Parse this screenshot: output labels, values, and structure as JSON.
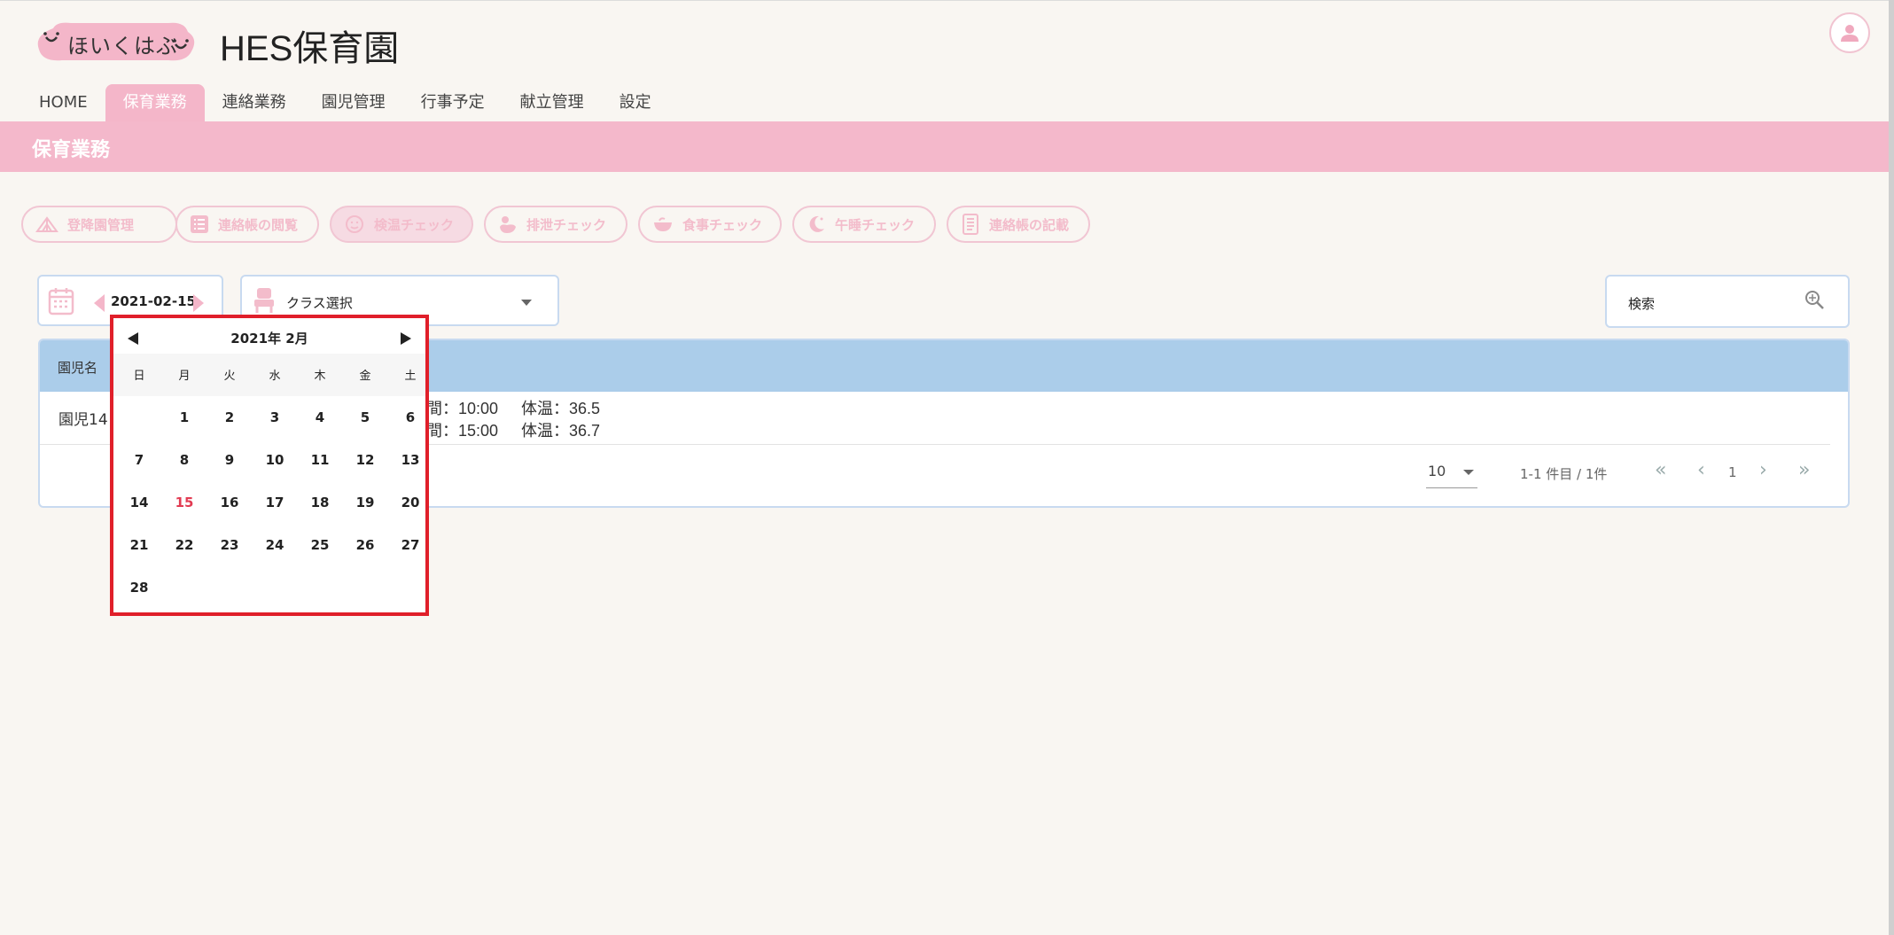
{
  "header": {
    "logo_text": "ほいくはぶ",
    "site_title": "HES保育園"
  },
  "nav": {
    "tabs": [
      {
        "label": "HOME"
      },
      {
        "label": "保育業務"
      },
      {
        "label": "連絡業務"
      },
      {
        "label": "園児管理"
      },
      {
        "label": "行事予定"
      },
      {
        "label": "献立管理"
      },
      {
        "label": "設定"
      }
    ],
    "active_index": 1
  },
  "banner": {
    "title": "保育業務"
  },
  "functions": [
    {
      "label": "登降園管理",
      "icon": "tent-icon"
    },
    {
      "label": "連絡帳の閲覧",
      "icon": "list-icon"
    },
    {
      "label": "検温チェック",
      "icon": "thermometer-face-icon"
    },
    {
      "label": "排泄チェック",
      "icon": "duck-icon"
    },
    {
      "label": "食事チェック",
      "icon": "bowl-icon"
    },
    {
      "label": "午睡チェック",
      "icon": "moon-stars-icon"
    },
    {
      "label": "連絡帳の記載",
      "icon": "notebook-icon"
    }
  ],
  "controls": {
    "date": "2021-02-15",
    "class_select": "クラス選択",
    "search_label": "検索"
  },
  "table": {
    "header": "園児名",
    "row_name": "園児14",
    "lines": [
      {
        "time": "間：10:00",
        "temp": "体温：36.5"
      },
      {
        "time": "間：15:00",
        "temp": "体温：36.7"
      }
    ]
  },
  "pagination": {
    "per_page": "10",
    "range": "1-1 件目 / 1件",
    "page": "1"
  },
  "calendar": {
    "title": "2021年 2月",
    "weekdays": [
      "日",
      "月",
      "火",
      "水",
      "木",
      "金",
      "土"
    ],
    "first_weekday": 1,
    "days_in_month": 28,
    "selected_day": 15
  },
  "colors": {
    "accent_pink": "#f4b6c9",
    "header_blue": "#abcdea",
    "highlight_red": "#e01f2a"
  }
}
